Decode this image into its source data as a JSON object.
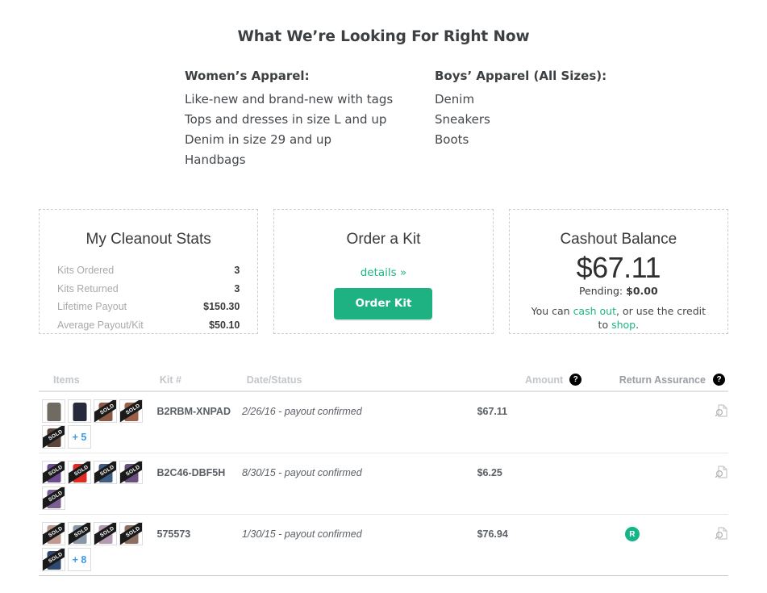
{
  "looking_for": {
    "title": "What We’re Looking For Right Now",
    "columns": [
      {
        "heading": "Women’s Apparel:",
        "items": [
          "Like-new and brand-new with tags",
          "Tops and dresses in size L and up",
          "Denim in size 29 and up",
          "Handbags"
        ]
      },
      {
        "heading": "Boys’ Apparel (All Sizes):",
        "items": [
          "Denim",
          "Sneakers",
          "Boots"
        ]
      }
    ]
  },
  "cards": {
    "stats": {
      "title": "My Cleanout Stats",
      "rows": [
        {
          "label": "Kits Ordered",
          "value": "3"
        },
        {
          "label": "Kits Returned",
          "value": "3"
        },
        {
          "label": "Lifetime Payout",
          "value": "$150.30"
        },
        {
          "label": "Average Payout/Kit",
          "value": "$50.10"
        }
      ]
    },
    "order_kit": {
      "title": "Order a Kit",
      "details_link": "details »",
      "button_label": "Order Kit",
      "button_color": "#1eb182"
    },
    "cashout": {
      "title": "Cashout Balance",
      "balance": "$67.11",
      "pending_label": "Pending:",
      "pending_value": "$0.00",
      "note_prefix": "You can ",
      "note_link_1": "cash out",
      "note_middle": ", or use the credit to ",
      "note_link_2": "shop",
      "note_suffix": ".",
      "link_color": "#1db584"
    }
  },
  "kit_table": {
    "headers": {
      "items": "Items",
      "kit_number": "Kit #",
      "date_status": "Date/Status",
      "amount": "Amount",
      "amount_help": "?",
      "return_assurance": "Return Assurance",
      "return_assurance_help": "?"
    },
    "rows": [
      {
        "kit_number": "B2RBM-XNPAD",
        "date_status": "2/26/16 -  payout confirmed",
        "amount": "$67.11",
        "return_assurance": false,
        "return_assurance_badge": "",
        "overflow_label": "+ 5",
        "thumbs": [
          {
            "sold": false,
            "sold_label": "",
            "color": "#6f6a62"
          },
          {
            "sold": false,
            "sold_label": "",
            "color": "#262a3a"
          },
          {
            "sold": true,
            "sold_label": "SOLD",
            "color": "#8a5a46"
          },
          {
            "sold": true,
            "sold_label": "SOLD",
            "color": "#9a5f49"
          },
          {
            "sold": true,
            "sold_label": "SOLD",
            "color": "#5a4538"
          }
        ]
      },
      {
        "kit_number": "B2C46-DBF5H",
        "date_status": "8/30/15 -  payout confirmed",
        "amount": "$6.25",
        "return_assurance": false,
        "return_assurance_badge": "",
        "overflow_label": "",
        "thumbs": [
          {
            "sold": true,
            "sold_label": "SOLD",
            "color": "#6c4b8f"
          },
          {
            "sold": true,
            "sold_label": "SOLD",
            "color": "#e02b22"
          },
          {
            "sold": true,
            "sold_label": "SOLD",
            "color": "#3d5d85"
          },
          {
            "sold": true,
            "sold_label": "SOLD",
            "color": "#6b4f7e"
          },
          {
            "sold": true,
            "sold_label": "SOLD",
            "color": "#7b5f93"
          }
        ]
      },
      {
        "kit_number": "575573",
        "date_status": "1/30/15 -  payout confirmed",
        "amount": "$76.94",
        "return_assurance": true,
        "return_assurance_badge": "R",
        "overflow_label": "+ 8",
        "thumbs": [
          {
            "sold": true,
            "sold_label": "SOLD",
            "color": "#c09a8e"
          },
          {
            "sold": true,
            "sold_label": "SOLD",
            "color": "#8a97a8"
          },
          {
            "sold": true,
            "sold_label": "SOLD",
            "color": "#b49ab0"
          },
          {
            "sold": true,
            "sold_label": "SOLD",
            "color": "#8d6f62"
          },
          {
            "sold": true,
            "sold_label": "SOLD",
            "color": "#2f4a72"
          }
        ]
      }
    ]
  }
}
